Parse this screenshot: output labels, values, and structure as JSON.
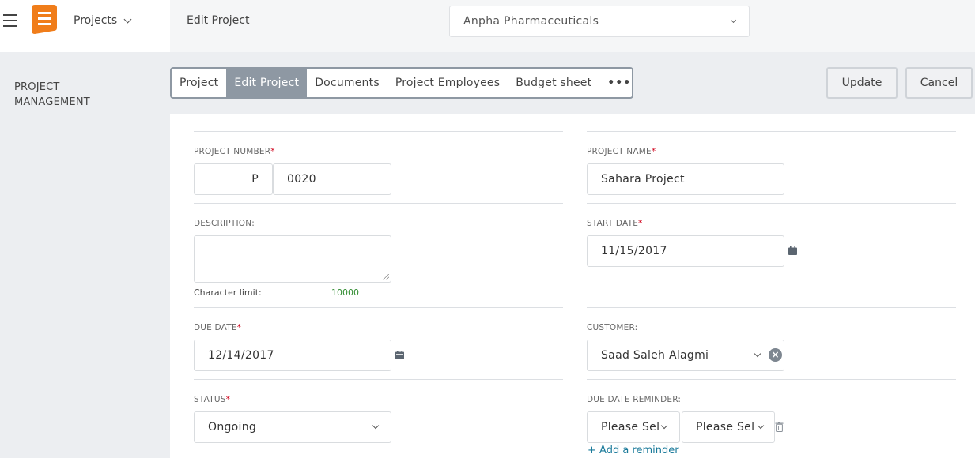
{
  "header": {
    "app_name": "Projects",
    "page_title": "Edit Project",
    "company": "Anpha Pharmaceuticals",
    "brand_color": "#f07d1a"
  },
  "sidebar": {
    "section_line1": "PROJECT",
    "section_line2": "MANAGEMENT"
  },
  "tabs": [
    {
      "label": "Project",
      "active": false
    },
    {
      "label": "Edit Project",
      "active": true
    },
    {
      "label": "Documents",
      "active": false
    },
    {
      "label": "Project Employees",
      "active": false
    },
    {
      "label": "Budget sheet",
      "active": false
    },
    {
      "label": "•••",
      "active": false
    }
  ],
  "actions": {
    "update_label": "Update",
    "cancel_label": "Cancel"
  },
  "form": {
    "project_number": {
      "label": "PROJECT NUMBER",
      "required_mark": "*",
      "prefix": "P",
      "value": "0020"
    },
    "project_name": {
      "label": "PROJECT NAME",
      "required_mark": "*",
      "value": "Sahara Project"
    },
    "description": {
      "label": "DESCRIPTION:",
      "value": "",
      "char_limit_label": "Character limit:",
      "char_limit_value": "10000"
    },
    "start_date": {
      "label": "START DATE",
      "required_mark": "*",
      "value": "11/15/2017"
    },
    "due_date": {
      "label": "DUE DATE",
      "required_mark": "*",
      "value": "12/14/2017"
    },
    "customer": {
      "label": "CUSTOMER:",
      "value": "Saad Saleh Alagmi"
    },
    "status": {
      "label": "STATUS",
      "required_mark": "*",
      "value": "Ongoing"
    },
    "due_date_reminder": {
      "label": "DUE DATE REMINDER:",
      "select1": "Please Sel",
      "select2": "Please Sel",
      "add_link": "+ Add a reminder"
    }
  }
}
